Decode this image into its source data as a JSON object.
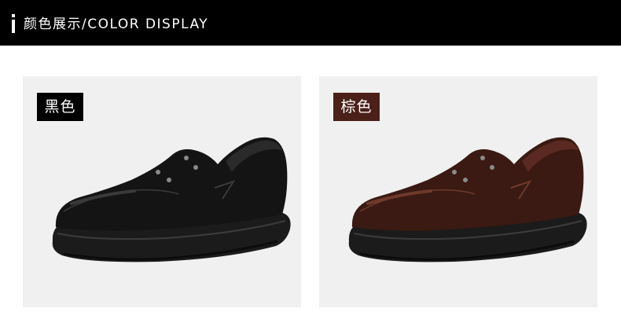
{
  "header": {
    "title": "颜色展示/COLOR DISPLAY"
  },
  "colors": [
    {
      "label": "黑色",
      "tag_bg": "#000000",
      "shoe_upper": "#141414",
      "shoe_highlight": "#3a3a3a",
      "shoe_sole": "#1b1b1b",
      "lining": "#2a2a2a"
    },
    {
      "label": "棕色",
      "tag_bg": "#4a2018",
      "shoe_upper": "#3a1a12",
      "shoe_highlight": "#6e3a2c",
      "shoe_sole": "#1b1b1b",
      "lining": "#5a2a22"
    }
  ]
}
